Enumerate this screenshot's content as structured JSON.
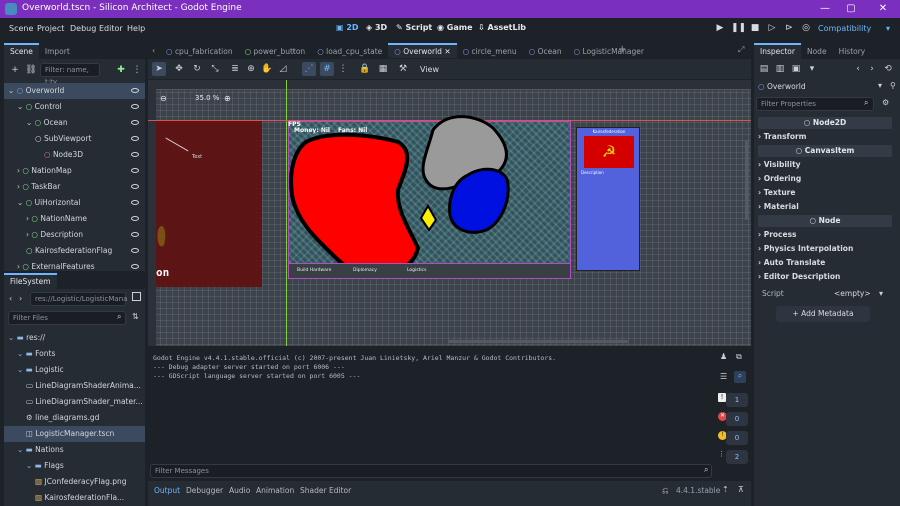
{
  "window": {
    "title": "Overworld.tscn - Silicon Architect - Godot Engine",
    "min": "—",
    "max": "▢",
    "close": "✕"
  },
  "menus": [
    "Scene",
    "Project",
    "Debug",
    "Editor",
    "Help"
  ],
  "workspaces": [
    {
      "label": "2D",
      "active": true
    },
    {
      "label": "3D"
    },
    {
      "label": "Script"
    },
    {
      "label": "Game"
    },
    {
      "label": "AssetLib"
    }
  ],
  "renderer": "Compatibility",
  "scene_dock": {
    "tabs": [
      "Scene",
      "Import"
    ],
    "filter_placeholder": "Filter: name, t:ty",
    "tree": [
      {
        "label": "Overworld",
        "depth": 0,
        "color": "#8da5f3",
        "selected": true
      },
      {
        "label": "Control",
        "depth": 1,
        "color": "#8eef97"
      },
      {
        "label": "Ocean",
        "depth": 2,
        "color": "#8eef97"
      },
      {
        "label": "SubViewport",
        "depth": 3,
        "color": "#e0e0e0"
      },
      {
        "label": "Node3D",
        "depth": 4,
        "color": "#fc7f7f"
      },
      {
        "label": "NationMap",
        "depth": 1,
        "color": "#8eef97"
      },
      {
        "label": "TaskBar",
        "depth": 1,
        "color": "#8eef97"
      },
      {
        "label": "UiHorizontal",
        "depth": 1,
        "color": "#8eef97"
      },
      {
        "label": "NationName",
        "depth": 2,
        "color": "#8eef97"
      },
      {
        "label": "Description",
        "depth": 2,
        "color": "#8eef97"
      },
      {
        "label": "KairosfederationFlag",
        "depth": 2,
        "color": "#8eef97"
      },
      {
        "label": "ExternalFeatures",
        "depth": 1,
        "color": "#8eef97"
      }
    ]
  },
  "filesystem": {
    "tab": "FileSystem",
    "path": "res://Logistic/LogisticMana",
    "filter_placeholder": "Filter Files",
    "items": [
      {
        "label": "res://",
        "depth": 0,
        "type": "folder"
      },
      {
        "label": "Fonts",
        "depth": 1,
        "type": "folder"
      },
      {
        "label": "Logistic",
        "depth": 1,
        "type": "folder"
      },
      {
        "label": "LineDiagramShaderAnima...",
        "depth": 2,
        "type": "file"
      },
      {
        "label": "LineDiagramShader_mater...",
        "depth": 2,
        "type": "file"
      },
      {
        "label": "line_diagrams.gd",
        "depth": 2,
        "type": "gear"
      },
      {
        "label": "LogisticManager.tscn",
        "depth": 2,
        "type": "scene",
        "selected": true
      },
      {
        "label": "Nations",
        "depth": 1,
        "type": "folder"
      },
      {
        "label": "Flags",
        "depth": 2,
        "type": "folder"
      },
      {
        "label": "JConfederacyFlag.png",
        "depth": 3,
        "type": "image"
      },
      {
        "label": "KairosfederationFla...",
        "depth": 3,
        "type": "image"
      }
    ]
  },
  "scene_tabs": [
    "cpu_fabrication",
    "power_button",
    "load_cpu_state",
    "Overworld",
    "circle_menu",
    "Ocean",
    "LogisticManager"
  ],
  "active_scene_tab": "Overworld",
  "toolbar": {
    "view_label": "View",
    "zoom": "35.0 %"
  },
  "game": {
    "fps": "FPS",
    "money": "Money: Nil",
    "fans": "Fans: Nil",
    "tab1": "Build Hardware",
    "tab2": "Diplomacy",
    "tab3": "Logistics",
    "panel_title": "Kairosfederation",
    "panel_desc": "Description",
    "left_text": "on",
    "left_small": "Text"
  },
  "output": {
    "lines": [
      "Godot Engine v4.4.1.stable.official (c) 2007-present Juan Linietsky, Ariel Manzur & Godot Contributors.",
      "--- Debug adapter server started on port 6006 ---",
      "--- GDScript language server started on port 6005 ---"
    ],
    "filter_placeholder": "Filter Messages",
    "counts": [
      "1",
      "0",
      "0",
      "2"
    ]
  },
  "bottom_tabs": [
    "Output",
    "Debugger",
    "Audio",
    "Animation",
    "Shader Editor"
  ],
  "version": "4.4.1.stable",
  "inspector": {
    "tabs": [
      "Inspector",
      "Node",
      "History"
    ],
    "node": "Overworld",
    "filter_placeholder": "Filter Properties",
    "groups": [
      {
        "kind": "cat",
        "label": "Node2D"
      },
      {
        "kind": "sec",
        "label": "Transform"
      },
      {
        "kind": "cat",
        "label": "CanvasItem"
      },
      {
        "kind": "sec",
        "label": "Visibility"
      },
      {
        "kind": "sec",
        "label": "Ordering"
      },
      {
        "kind": "sec",
        "label": "Texture"
      },
      {
        "kind": "sec",
        "label": "Material"
      },
      {
        "kind": "cat",
        "label": "Node"
      },
      {
        "kind": "sec",
        "label": "Process"
      },
      {
        "kind": "sec",
        "label": "Physics Interpolation"
      },
      {
        "kind": "sec",
        "label": "Auto Translate"
      },
      {
        "kind": "sec",
        "label": "Editor Description"
      }
    ],
    "script_label": "Script",
    "script_value": "<empty>",
    "add_metadata": "Add Metadata"
  }
}
